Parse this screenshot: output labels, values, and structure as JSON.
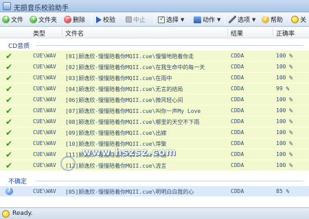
{
  "window": {
    "title": "无损音乐校验助手"
  },
  "toolbar": {
    "file": "文件",
    "folder": "文件夹",
    "delete": "删除",
    "verify": "校验",
    "stop": "中止",
    "select": "选择",
    "action": "动作",
    "options": "选项",
    "help": "帮助",
    "about": "关"
  },
  "columns": {
    "type": "类型",
    "filename": "文件名",
    "result": "结果",
    "accuracy": "正确率"
  },
  "groups": [
    {
      "label": "CD音质",
      "rows": [
        {
          "type": "CUE\\WAV",
          "filename": "[01]顾逸欣-慢慢陪着你MQII.cue\\慢慢地陪着你走",
          "result": "CDDA",
          "accuracy": "100 %"
        },
        {
          "type": "CUE\\WAV",
          "filename": "[02]顾逸欣-慢慢陪着你MQII.cue\\在我生命中的每一天",
          "result": "CDDA",
          "accuracy": "100 %"
        },
        {
          "type": "CUE\\WAV",
          "filename": "[03]顾逸欣-慢慢陪着你MQII.cue\\在雨中",
          "result": "CDDA",
          "accuracy": "100 %"
        },
        {
          "type": "CUE\\WAV",
          "filename": "[04]顾逸欣-慢慢陪着你MQII.cue\\无言的结局",
          "result": "CDDA",
          "accuracy": "99 %"
        },
        {
          "type": "CUE\\WAV",
          "filename": "[06]顾逸欣-慢慢陪着你MQII.cue\\微风轻心间",
          "result": "CDDA",
          "accuracy": "100 %"
        },
        {
          "type": "CUE\\WAV",
          "filename": "[07]顾逸欣-慢慢陪着你MQII.cue\\叫你一声My Love",
          "result": "CDDA",
          "accuracy": "100 %"
        },
        {
          "type": "CUE\\WAV",
          "filename": "[08]顾逸欣-慢慢陪着你MQII.cue\\哪里的天空不下雨",
          "result": "CDDA",
          "accuracy": "100 %"
        },
        {
          "type": "CUE\\WAV",
          "filename": "[09]顾逸欣-慢慢陪着你MQII.cue\\出嫁",
          "result": "CDDA",
          "accuracy": "100 %"
        },
        {
          "type": "CUE\\WAV",
          "filename": "[10]顾逸欣-慢慢陪着你MQII.cue\\萍聚",
          "result": "CDDA",
          "accuracy": "100 %"
        },
        {
          "type": "CUE\\WAV",
          "filename": "[11]顾逸欣-慢慢陪着你MQII.cue\\水晶",
          "result": "CDDA",
          "accuracy": "100 %"
        },
        {
          "type": "CUE\\WAV",
          "filename": "[12]顾逸欣-慢慢陪着你MQII.cue\\流言",
          "result": "CDDA",
          "accuracy": "100 %"
        }
      ]
    },
    {
      "label": "不确定",
      "rows": [
        {
          "type": "CUE\\WAV",
          "filename": "[05]顾逸欣-慢慢陪着你MQII.cue\\明明白白我的心",
          "result": "CDDA",
          "accuracy": "85 %"
        }
      ]
    }
  ],
  "watermark": "www.hszsz.com",
  "status": {
    "text": "Ready."
  },
  "colors": {
    "row_ok_bg": "#f2f9cf",
    "row_unsure_bg": "#dbe9fb",
    "check_green": "#2f9b1a",
    "group_label_blue": "#1d4aa0"
  }
}
